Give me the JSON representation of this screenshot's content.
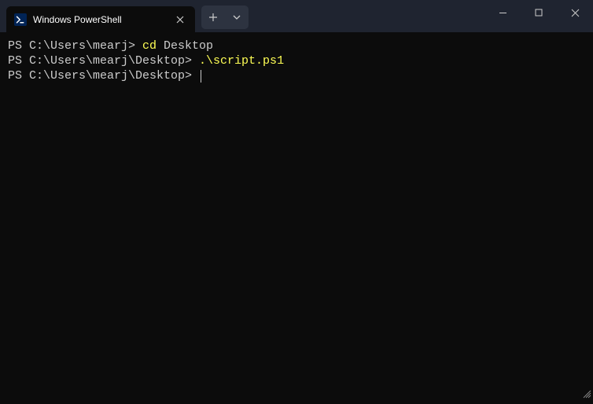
{
  "tab": {
    "title": "Windows PowerShell",
    "icon_name": "powershell-icon"
  },
  "terminal": {
    "lines": [
      {
        "prompt": "PS C:\\Users\\mearj> ",
        "keyword": "cd",
        "arg": " Desktop"
      },
      {
        "prompt": "PS C:\\Users\\mearj\\Desktop> ",
        "path": ".\\script.ps1"
      },
      {
        "prompt": "PS C:\\Users\\mearj\\Desktop> ",
        "cursor": true
      }
    ]
  }
}
